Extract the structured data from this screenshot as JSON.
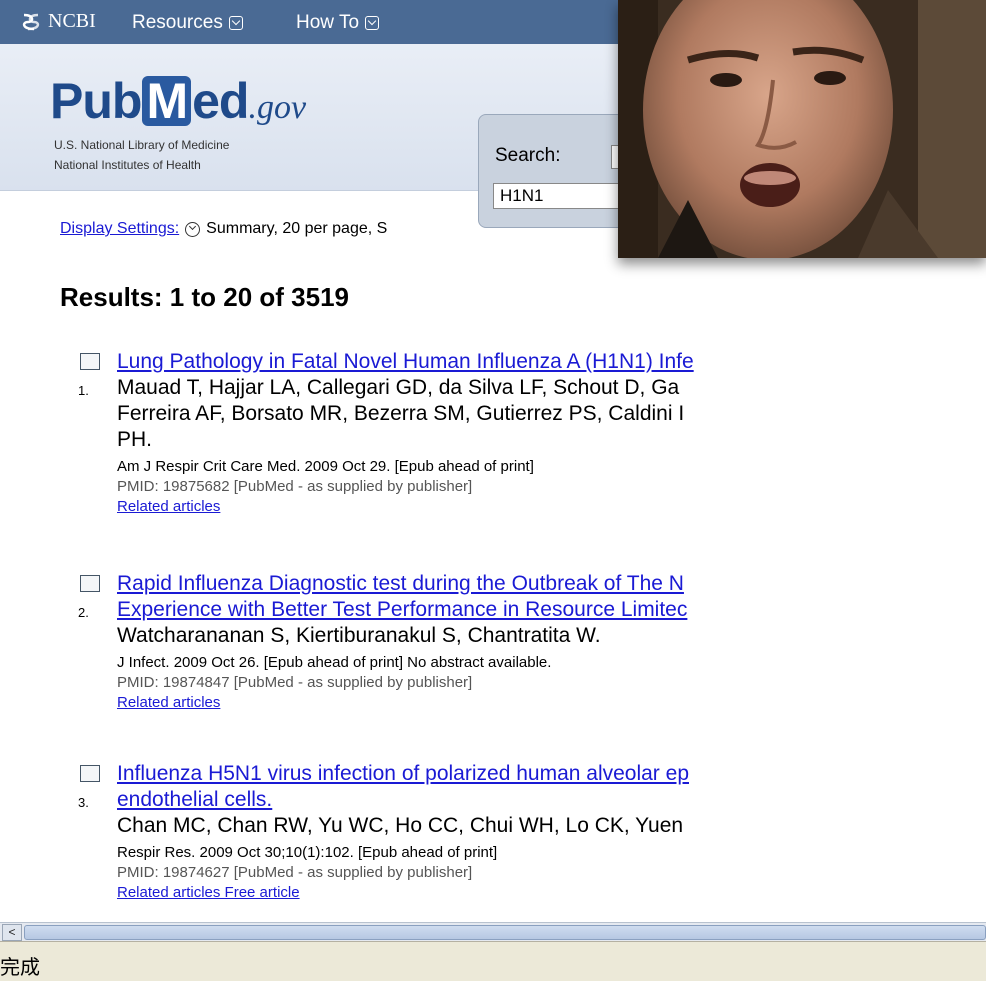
{
  "ncbi_bar": {
    "logo_text": "NCBI",
    "menu": [
      {
        "label": "Resources"
      },
      {
        "label": "How To"
      }
    ]
  },
  "masthead": {
    "logo": {
      "pub": "Pub",
      "m": "M",
      "ed": "ed",
      "gov": ".gov"
    },
    "tagline_line1": "U.S. National Library of Medicine",
    "tagline_line2": "National Institutes of Health",
    "search_label": "Search:",
    "search_value": "H1N1"
  },
  "display_settings": {
    "link": "Display Settings:",
    "value": "Summary, 20 per page, S"
  },
  "results_heading": "Results: 1 to 20 of 3519",
  "results": [
    {
      "num": "1.",
      "title_lines": [
        "Lung Pathology in Fatal Novel Human Influenza A (H1N1) Infe"
      ],
      "author_lines": [
        "Mauad T, Hajjar LA, Callegari GD, da Silva LF, Schout D, Ga",
        "Ferreira AF, Borsato MR, Bezerra SM, Gutierrez PS, Caldini I",
        "PH."
      ],
      "journal": "Am J Respir Crit Care Med. 2009 Oct 29. [Epub ahead of print]",
      "pmid": "PMID: 19875682 [PubMed - as supplied by publisher]",
      "related": "Related articles"
    },
    {
      "num": "2.",
      "title_lines": [
        "Rapid Influenza Diagnostic test during the Outbreak of The N",
        "Experience with Better Test Performance in Resource Limitec"
      ],
      "author_lines": [
        "Watcharananan S, Kiertiburanakul S, Chantratita W."
      ],
      "journal": "J Infect. 2009 Oct 26. [Epub ahead of print] No abstract available.",
      "pmid": "PMID: 19874847 [PubMed - as supplied by publisher]",
      "related": "Related articles"
    },
    {
      "num": "3.",
      "title_lines": [
        "Influenza H5N1 virus infection of polarized human alveolar ep",
        "endothelial cells."
      ],
      "author_lines": [
        "Chan MC, Chan RW, Yu WC, Ho CC, Chui WH, Lo CK, Yuen"
      ],
      "journal": "Respir Res. 2009 Oct 30;10(1):102. [Epub ahead of print]",
      "pmid": "PMID: 19874627 [PubMed - as supplied by publisher]",
      "related": "Related articles    Free article"
    }
  ],
  "scrollbar": {
    "left_arrow": "<"
  },
  "status_bar": {
    "text": "完成"
  }
}
